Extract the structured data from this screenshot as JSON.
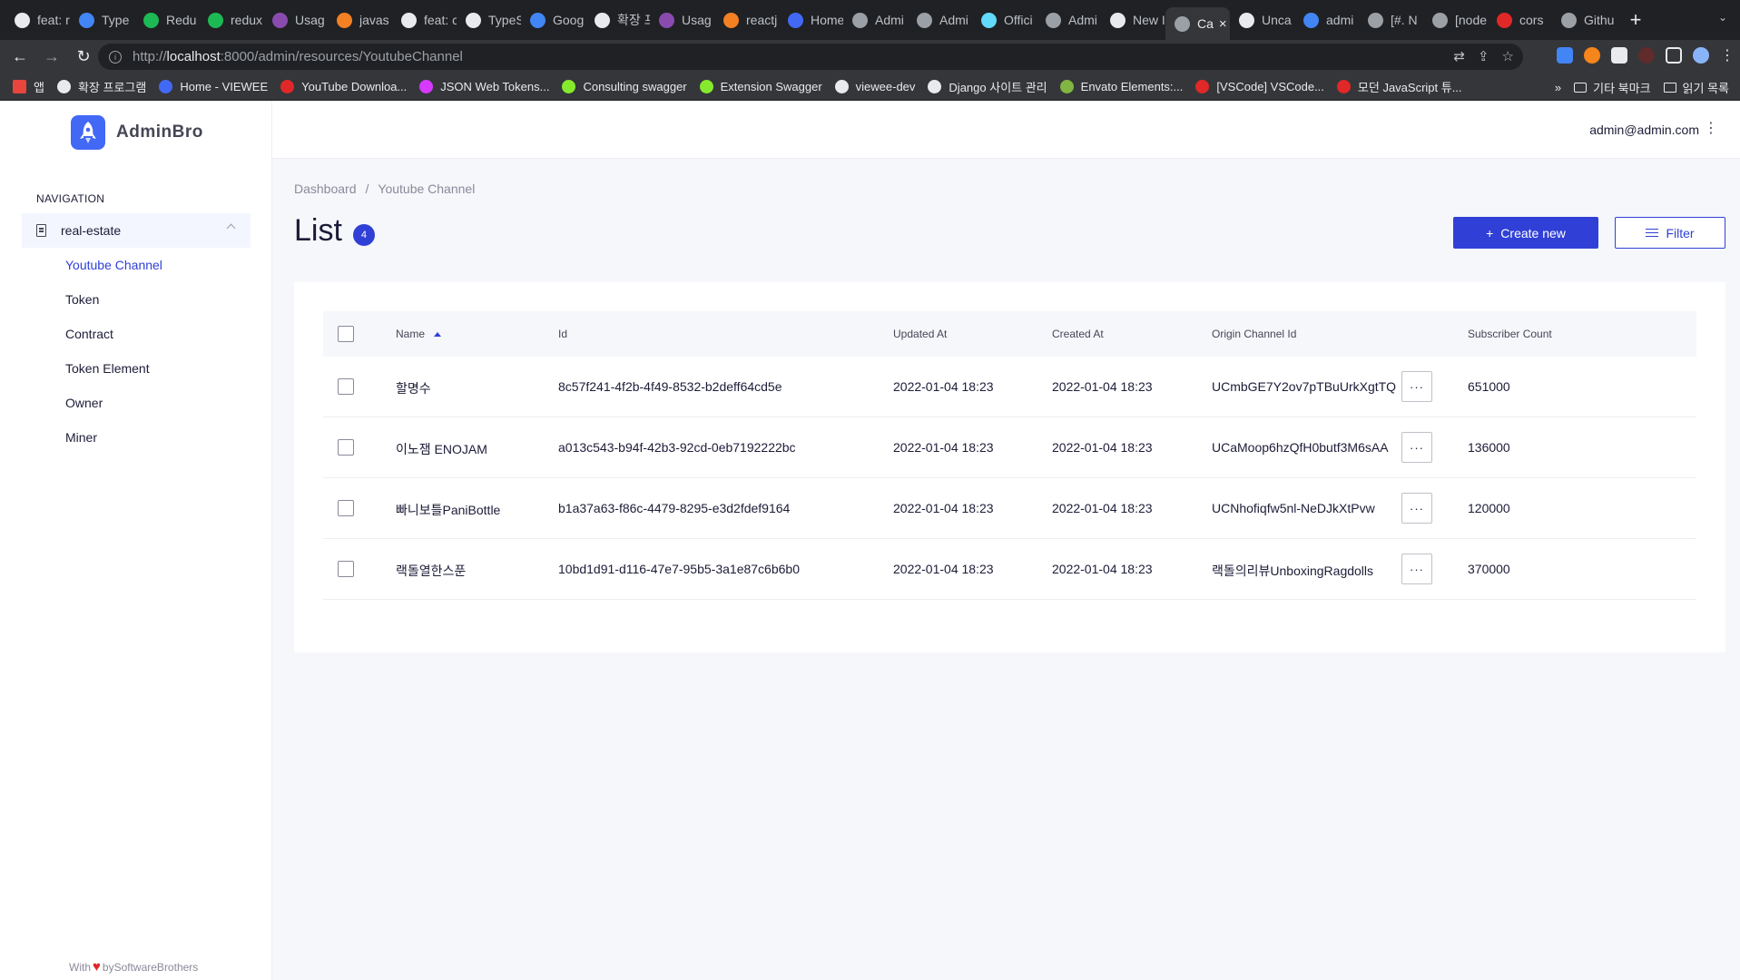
{
  "browser": {
    "tabs": [
      {
        "label": "feat: r",
        "icon": "github-icon",
        "color": "#e8eaed"
      },
      {
        "label": "Type",
        "icon": "google-icon",
        "color": "#4285f4"
      },
      {
        "label": "Redu",
        "icon": "v-icon",
        "color": "#1db954"
      },
      {
        "label": "redux",
        "icon": "v-icon",
        "color": "#1db954"
      },
      {
        "label": "Usag",
        "icon": "graphql-icon",
        "color": "#8a4baf"
      },
      {
        "label": "javas",
        "icon": "stackoverflow-icon",
        "color": "#f48024"
      },
      {
        "label": "feat: c",
        "icon": "github-icon",
        "color": "#e8eaed"
      },
      {
        "label": "TypeS",
        "icon": "github-icon",
        "color": "#e8eaed"
      },
      {
        "label": "Goog",
        "icon": "google-icon",
        "color": "#4285f4"
      },
      {
        "label": "확장 프",
        "icon": "puzzle-icon",
        "color": "#e8eaed"
      },
      {
        "label": "Usag",
        "icon": "graphql-icon",
        "color": "#8a4baf"
      },
      {
        "label": "reactj",
        "icon": "stackoverflow-icon",
        "color": "#f48024"
      },
      {
        "label": "Home",
        "icon": "adminbro-icon",
        "color": "#4268f6"
      },
      {
        "label": "Admi",
        "icon": "globe-icon",
        "color": "#9aa0a6"
      },
      {
        "label": "Admi",
        "icon": "globe-icon",
        "color": "#9aa0a6"
      },
      {
        "label": "Offici",
        "icon": "react-icon",
        "color": "#61dafb"
      },
      {
        "label": "Admi",
        "icon": "globe-icon",
        "color": "#9aa0a6"
      },
      {
        "label": "New I",
        "icon": "github-icon",
        "color": "#e8eaed"
      },
      {
        "label": "Ca",
        "icon": "globe-icon",
        "color": "#9aa0a6",
        "active": true
      },
      {
        "label": "Unca",
        "icon": "github-icon",
        "color": "#e8eaed"
      },
      {
        "label": "admi",
        "icon": "google-icon",
        "color": "#4285f4"
      },
      {
        "label": "[#. N",
        "icon": "notion-icon",
        "color": "#9aa0a6"
      },
      {
        "label": "[node",
        "icon": "notion-icon",
        "color": "#9aa0a6"
      },
      {
        "label": "cors",
        "icon": "bookmark-red-icon",
        "color": "#e02828"
      },
      {
        "label": "Githu",
        "icon": "globe-icon",
        "color": "#9aa0a6"
      }
    ],
    "url_prefix": "http://",
    "url_host": "localhost",
    "url_rest": ":8000/admin/resources/YoutubeChannel",
    "bookmarks": [
      {
        "label": "앱",
        "color": "#e8453c"
      },
      {
        "label": "확장 프로그램",
        "color": "#e8eaed"
      },
      {
        "label": "Home - VIEWEE",
        "color": "#4268f6"
      },
      {
        "label": "YouTube Downloa...",
        "color": "#e02828"
      },
      {
        "label": "JSON Web Tokens...",
        "color": "#d63aff"
      },
      {
        "label": "Consulting swagger",
        "color": "#85ea2d"
      },
      {
        "label": "Extension Swagger",
        "color": "#85ea2d"
      },
      {
        "label": "viewee-dev",
        "color": "#e8eaed"
      },
      {
        "label": "Django 사이트 관리",
        "color": "#e8eaed"
      },
      {
        "label": "Envato Elements:...",
        "color": "#82b541"
      },
      {
        "label": "[VSCode] VSCode...",
        "color": "#e02828"
      },
      {
        "label": "모던 JavaScript 튜...",
        "color": "#e02828"
      }
    ],
    "bookmarks_more": "»",
    "other_bookmarks": "기타 북마크",
    "reading_list": "읽기 목록"
  },
  "app": {
    "brand": "AdminBro",
    "brand_color": "#4268f6",
    "accent_color": "#3040d6",
    "nav_heading": "NAVIGATION",
    "nav_group": "real-estate",
    "nav_items": [
      {
        "label": "Youtube Channel",
        "active": true
      },
      {
        "label": "Token"
      },
      {
        "label": "Contract"
      },
      {
        "label": "Token Element"
      },
      {
        "label": "Owner"
      },
      {
        "label": "Miner"
      }
    ],
    "footer_with": "With",
    "footer_by": "bySoftwareBrothers",
    "user_email": "admin@admin.com",
    "breadcrumb": [
      "Dashboard",
      "/",
      "Youtube Channel"
    ],
    "title": "List",
    "count": "4",
    "create_label": "Create new",
    "filter_label": "Filter"
  },
  "table": {
    "columns": [
      "Name",
      "Id",
      "Updated At",
      "Created At",
      "Origin Channel Id",
      "Subscriber Count"
    ],
    "sorted_by": "Name",
    "rows": [
      [
        "할명수",
        "8c57f241-4f2b-4f49-8532-b2deff64cd5e",
        "2022-01-04 18:23",
        "2022-01-04 18:23",
        "UCmbGE7Y2ov7pTBuUrkXgtTQ",
        "651000"
      ],
      [
        "이노잼 ENOJAM",
        "a013c543-b94f-42b3-92cd-0eb7192222bc",
        "2022-01-04 18:23",
        "2022-01-04 18:23",
        "UCaMoop6hzQfH0butf3M6sAA",
        "136000"
      ],
      [
        "빠니보틀PaniBottle",
        "b1a37a63-f86c-4479-8295-e3d2fdef9164",
        "2022-01-04 18:23",
        "2022-01-04 18:23",
        "UCNhofiqfw5nl-NeDJkXtPvw",
        "120000"
      ],
      [
        "랙돌열한스푼",
        "10bd1d91-d116-47e7-95b5-3a1e87c6b6b0",
        "2022-01-04 18:23",
        "2022-01-04 18:23",
        "랙돌의리뷰UnboxingRagdolls",
        "370000"
      ]
    ],
    "row_action": "···"
  }
}
